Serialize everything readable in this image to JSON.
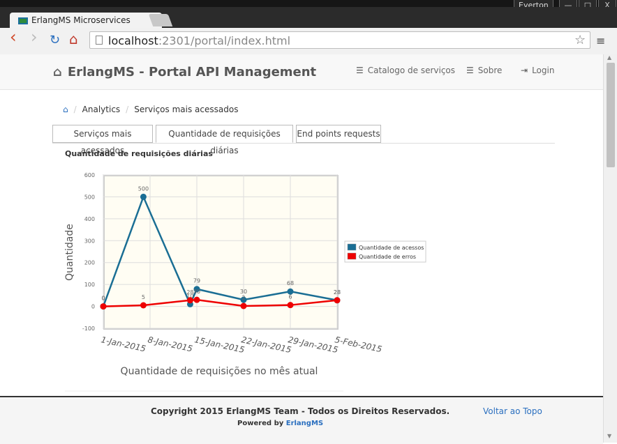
{
  "os": {
    "user": "Everton",
    "btn_min": "—",
    "btn_max": "□",
    "btn_close": "X"
  },
  "browser": {
    "tab_title": "ErlangMS Microservices",
    "tab_close": "×",
    "url_host": "localhost",
    "url_rest": ":2301/portal/index.html",
    "back": "‹",
    "forward": "›",
    "reload": "↻",
    "home": "⌂",
    "star": "☆",
    "menu": "≡"
  },
  "navbar": {
    "brand": "ErlangMS - Portal API Management",
    "links": [
      {
        "label": "Catalogo de serviços",
        "icon": "☰"
      },
      {
        "label": "Sobre",
        "icon": "☰"
      },
      {
        "label": "Login",
        "icon": "⇥"
      }
    ]
  },
  "breadcrumb": {
    "home_icon": "⌂",
    "items": [
      "Analytics",
      "Serviços mais acessados"
    ]
  },
  "tabs": [
    "Serviços mais acessados",
    "Quantidade de requisições diárias",
    "End points requests"
  ],
  "chart_title": "Quantidade de requisições diárias",
  "chart_data": {
    "type": "line",
    "ylabel": "Quantidade",
    "xlabel": "Quantidade de requisições no mês atual",
    "ylim": [
      -100,
      600
    ],
    "yticks": [
      "600",
      "500",
      "400",
      "300",
      "200",
      "100",
      "0",
      "-100"
    ],
    "xticks": [
      "1-Jan-2015",
      "8-Jan-2015",
      "15-Jan-2015",
      "22-Jan-2015",
      "29-Jan-2015",
      "5-Feb-2015"
    ],
    "grid": true,
    "legend_position": "right",
    "series": [
      {
        "name": "Quantidade de acessos",
        "color": "#1a6e94",
        "points": [
          [
            "2015-01-01",
            0
          ],
          [
            "2015-01-07",
            500
          ],
          [
            "2015-01-14",
            10
          ],
          [
            "2015-01-15",
            79
          ],
          [
            "2015-01-22",
            30
          ],
          [
            "2015-01-29",
            68
          ],
          [
            "2015-02-05",
            28
          ]
        ],
        "labels": [
          "0",
          "500",
          "10",
          "79",
          "30",
          "68",
          "28"
        ]
      },
      {
        "name": "Quantidade de erros",
        "color": "#ee0000",
        "points": [
          [
            "2015-01-01",
            0
          ],
          [
            "2015-01-07",
            5
          ],
          [
            "2015-01-14",
            28
          ],
          [
            "2015-01-15",
            30
          ],
          [
            "2015-01-22",
            2
          ],
          [
            "2015-01-29",
            6
          ],
          [
            "2015-02-05",
            28
          ]
        ],
        "labels": [
          "0",
          "5",
          "28",
          "30",
          "2",
          "6",
          "28"
        ]
      }
    ]
  },
  "footer": {
    "copyright": "Copyright 2015 ErlangMS Team - Todos os Direitos Reservados.",
    "powered_prefix": "Powered by",
    "powered_link": "ErlangMS",
    "back_to_top": "Voltar ao Topo"
  }
}
